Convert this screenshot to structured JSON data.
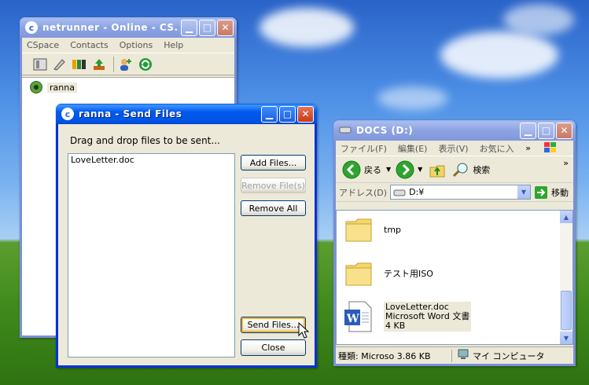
{
  "desktop": {},
  "cspace_window": {
    "title": "netrunner - Online - CS...",
    "menu": [
      "CSpace",
      "Contacts",
      "Options",
      "Help"
    ],
    "contact_name": "ranna"
  },
  "send_files_window": {
    "title": "ranna - Send Files",
    "instruction": "Drag and drop files to be sent...",
    "files": [
      "LoveLetter.doc"
    ],
    "buttons": {
      "add_files": "Add Files...",
      "remove_files": "Remove File(s)",
      "remove_all": "Remove All",
      "send_files": "Send Files...",
      "close": "Close"
    }
  },
  "explorer_window": {
    "title": "DOCS (D:)",
    "menu": [
      "ファイル(F)",
      "編集(E)",
      "表示(V)",
      "お気に入"
    ],
    "toolbar": {
      "back": "戻る",
      "search": "検索"
    },
    "address_label": "アドレス(D)",
    "address_value": "D:¥",
    "go_label": "移動",
    "items": [
      {
        "name": "tmp",
        "type": "folder"
      },
      {
        "name": "テスト用ISO",
        "type": "folder"
      },
      {
        "name": "LoveLetter.doc",
        "line2": "Microsoft Word 文書",
        "line3": "4 KB",
        "type": "word-doc"
      }
    ],
    "status": {
      "type_text": "種類: Microso 3.86 KB",
      "location": "マイ コンピュータ"
    }
  }
}
